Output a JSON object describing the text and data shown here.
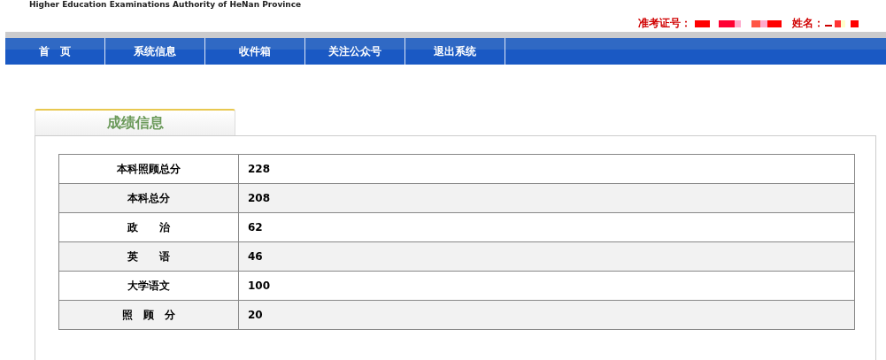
{
  "header": {
    "subtitle": "Higher Education Examinations Authority of HeNan Province",
    "exam_id_label": "准考证号：",
    "name_label": "姓名："
  },
  "nav": [
    {
      "label": "首　页"
    },
    {
      "label": "系统信息"
    },
    {
      "label": "收件箱"
    },
    {
      "label": "关注公众号"
    },
    {
      "label": "退出系统"
    }
  ],
  "panel": {
    "title": "成绩信息"
  },
  "scores": [
    {
      "subject": "本科照顾总分",
      "score": "228"
    },
    {
      "subject": "本科总分",
      "score": "208"
    },
    {
      "subject": "政　　治",
      "score": "62"
    },
    {
      "subject": "英　　语",
      "score": "46"
    },
    {
      "subject": "大学语文",
      "score": "100"
    },
    {
      "subject": "照　顾　分",
      "score": "20"
    }
  ]
}
